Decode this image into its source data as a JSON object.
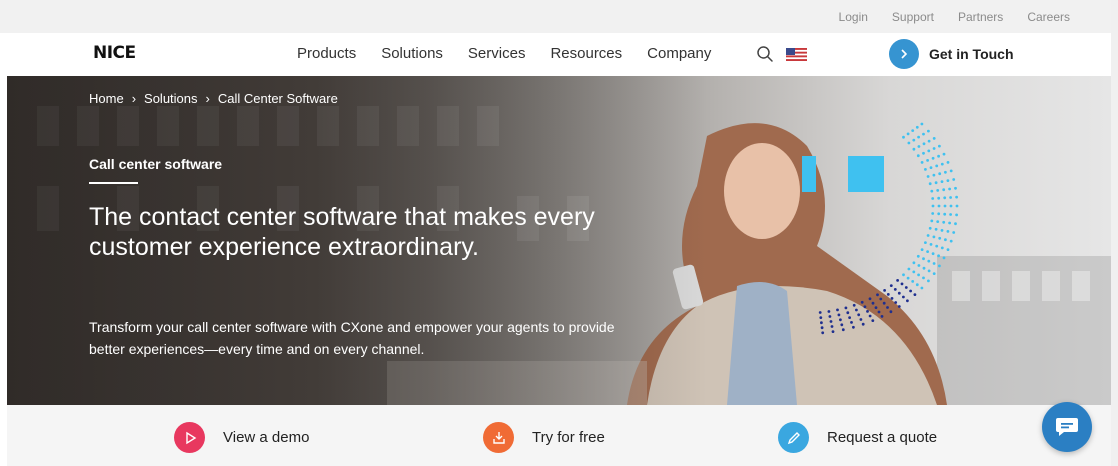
{
  "utility_nav": {
    "links": [
      "Login",
      "Support",
      "Partners",
      "Careers"
    ]
  },
  "main_nav": {
    "logo": "NICE",
    "items": [
      "Products",
      "Solutions",
      "Services",
      "Resources",
      "Company"
    ],
    "cta_label": "Get in Touch"
  },
  "hero": {
    "breadcrumb": [
      "Home",
      "Solutions",
      "Call Center Software"
    ],
    "eyebrow": "Call center software",
    "headline": "The contact center software that makes every customer experience extraordinary.",
    "subtext": "Transform your call center software with CXone and empower your agents to provide better experiences—every time and on every channel."
  },
  "actions": [
    {
      "label": "View a demo",
      "icon": "play-icon",
      "color": "#e8385f"
    },
    {
      "label": "Try for free",
      "icon": "download-icon",
      "color": "#f06b35"
    },
    {
      "label": "Request a quote",
      "icon": "pencil-icon",
      "color": "#3aa7e0"
    }
  ],
  "colors": {
    "accent_blue": "#3694d1",
    "chat_blue": "#2b7fc3",
    "deco_cyan": "#3fc1f0",
    "deco_navy": "#1f2f8f"
  }
}
